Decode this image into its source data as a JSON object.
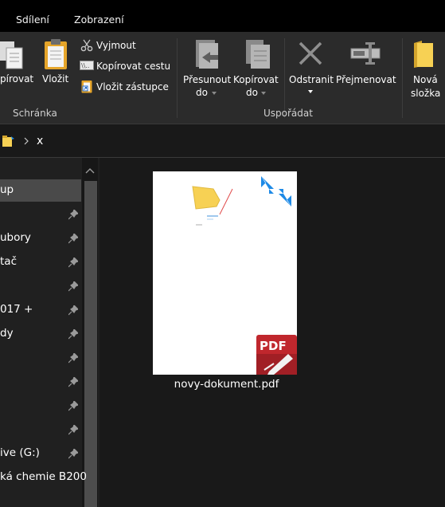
{
  "tabs": [
    {
      "label": "Sdílení"
    },
    {
      "label": "Zobrazení"
    }
  ],
  "ribbon": {
    "clipboard": {
      "copy_label": "pírovat",
      "paste_label": "Vložit",
      "cut_label": "Vyjmout",
      "copy_path_label": "Kopírovat cestu",
      "paste_shortcut_label": "Vložit zástupce",
      "group_label": "Schránka"
    },
    "organize": {
      "move_label_1": "Přesunout",
      "move_label_2": "do",
      "copy_label_1": "Kopírovat",
      "copy_label_2": "do",
      "delete_label": "Odstranit",
      "rename_label": "Přejmenovat",
      "group_label": "Uspořádat"
    },
    "new": {
      "new_folder_label_1": "Nová",
      "new_folder_label_2": "složka"
    }
  },
  "address": {
    "crumb": "x"
  },
  "nav": {
    "items": [
      {
        "label": "up",
        "pinned": false
      },
      {
        "label": "",
        "pinned": true
      },
      {
        "label": "ubory",
        "pinned": true
      },
      {
        "label": "tač",
        "pinned": true
      },
      {
        "label": "",
        "pinned": true
      },
      {
        "label": "017 +",
        "pinned": true
      },
      {
        "label": "dy",
        "pinned": true
      },
      {
        "label": "",
        "pinned": true
      },
      {
        "label": "",
        "pinned": true
      },
      {
        "label": "",
        "pinned": true
      },
      {
        "label": "",
        "pinned": true
      },
      {
        "label": "ive (G:)",
        "pinned": true
      },
      {
        "label": "ká chemie B200",
        "pinned": false
      }
    ]
  },
  "content": {
    "file": {
      "name": "novy-dokument.pdf",
      "badge": "PDF"
    }
  },
  "colors": {
    "pdf_red": "#c0272d",
    "folder_yellow": "#f7d154",
    "arrow_blue": "#1e8ae6"
  }
}
